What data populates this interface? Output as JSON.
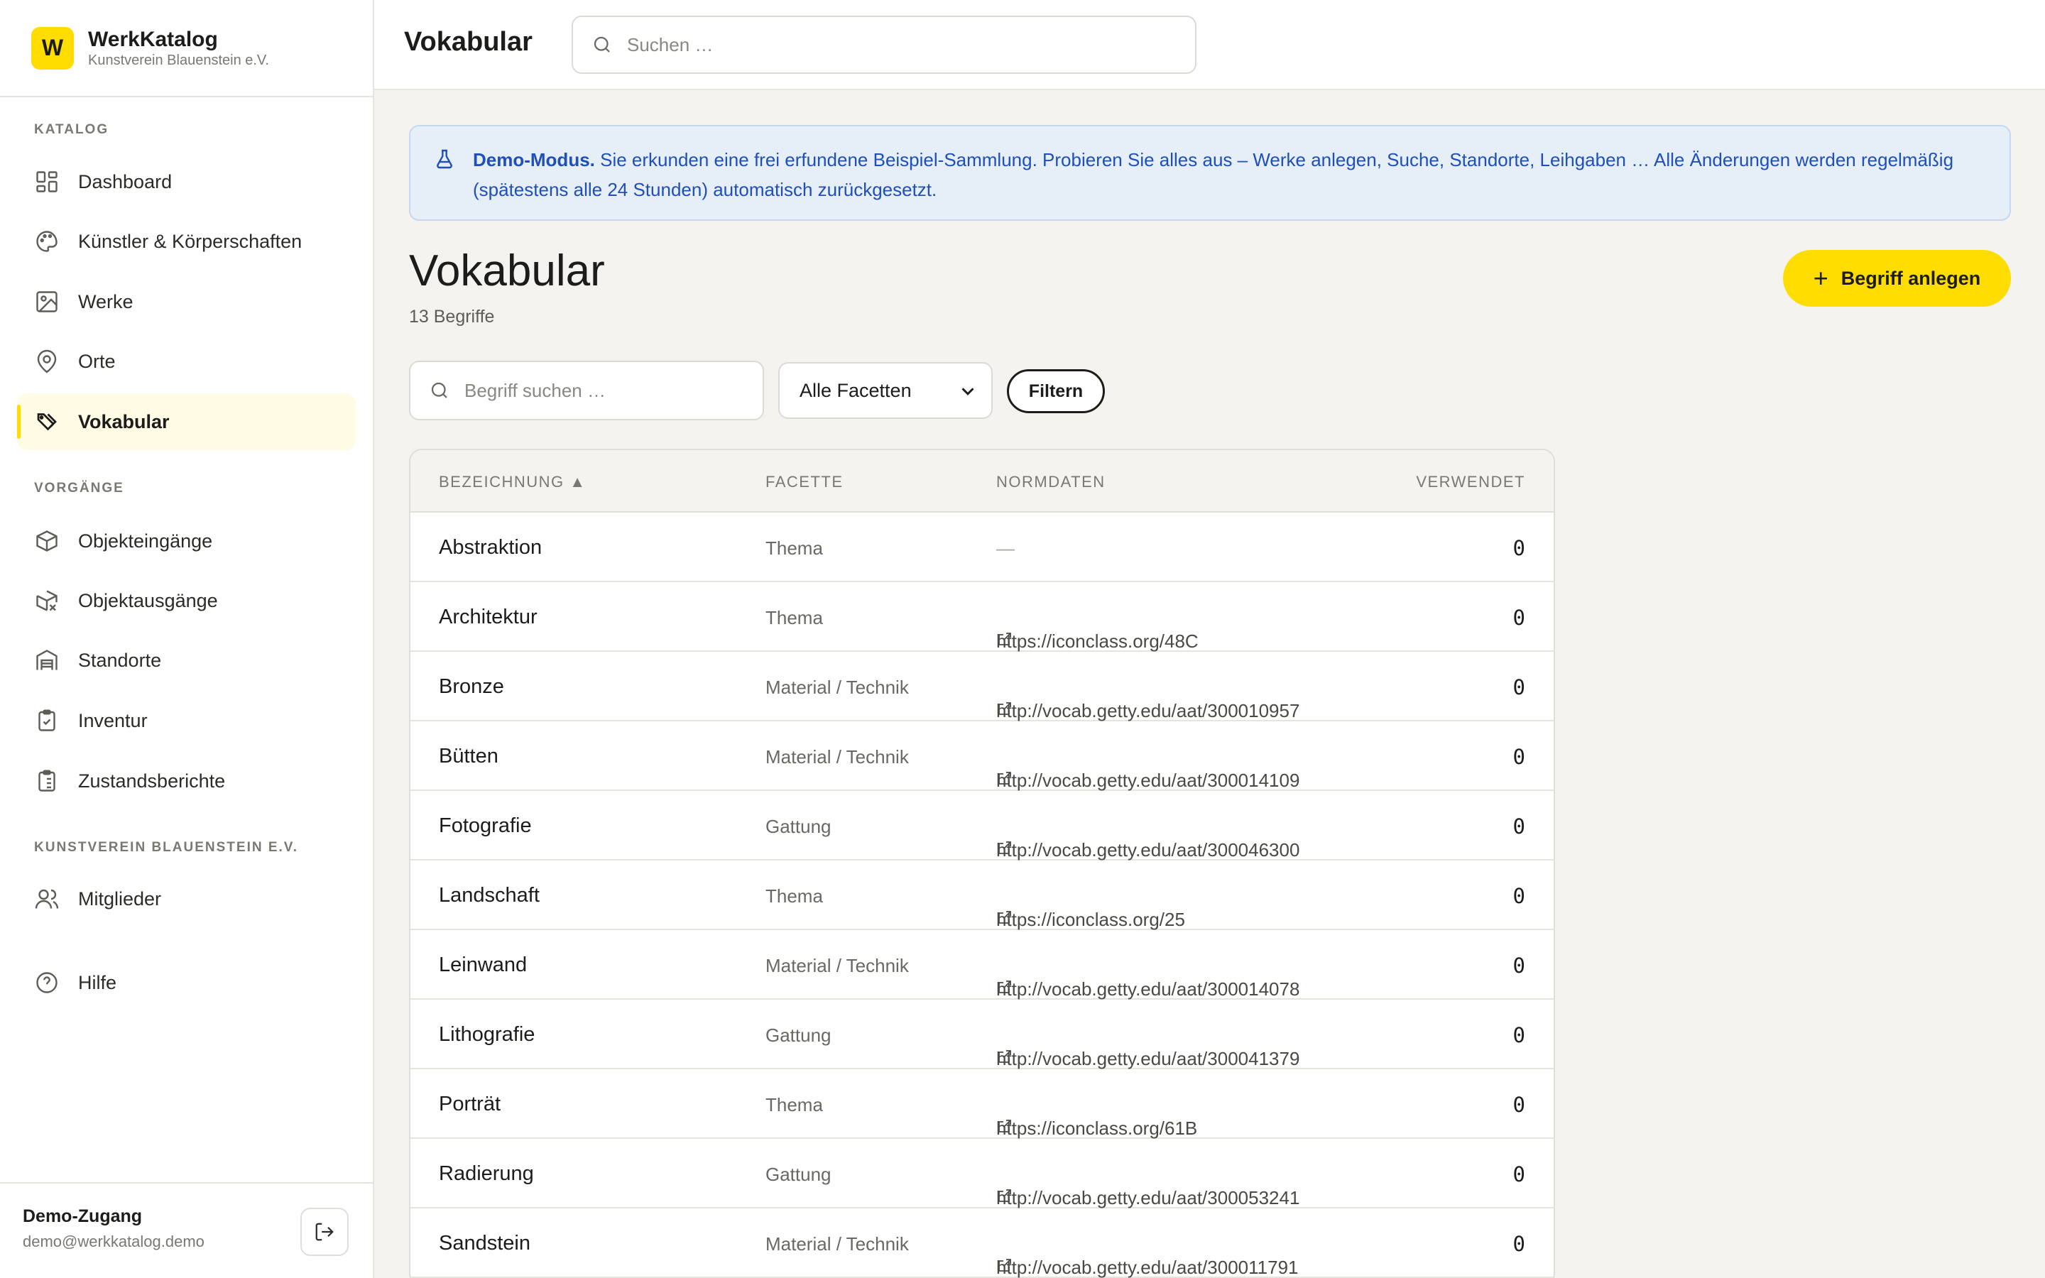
{
  "brand": {
    "logo_letter": "W",
    "title": "WerkKatalog",
    "subtitle": "Kunstverein Blauenstein e.V."
  },
  "sidebar": {
    "sections": [
      {
        "label": "KATALOG"
      },
      {
        "label": "VORGÄNGE"
      },
      {
        "label": "KUNSTVEREIN BLAUENSTEIN E.V."
      }
    ],
    "items": [
      {
        "label": "Dashboard",
        "icon": "dashboard-icon"
      },
      {
        "label": "Künstler & Körperschaften",
        "icon": "palette-icon"
      },
      {
        "label": "Werke",
        "icon": "image-icon"
      },
      {
        "label": "Orte",
        "icon": "map-pin-icon"
      },
      {
        "label": "Vokabular",
        "icon": "tag-icon",
        "active": true
      },
      {
        "label": "Objekteingänge",
        "icon": "box-in-icon"
      },
      {
        "label": "Objektausgänge",
        "icon": "box-out-icon"
      },
      {
        "label": "Standorte",
        "icon": "warehouse-icon"
      },
      {
        "label": "Inventur",
        "icon": "clipboard-check-icon"
      },
      {
        "label": "Zustandsberichte",
        "icon": "clipboard-list-icon"
      },
      {
        "label": "Mitglieder",
        "icon": "users-icon"
      },
      {
        "label": "Hilfe",
        "icon": "help-circle-icon"
      }
    ],
    "footer": {
      "user_name": "Demo-Zugang",
      "user_email": "demo@werkkatalog.demo"
    }
  },
  "topbar": {
    "title": "Vokabular",
    "search_placeholder": "Suchen …"
  },
  "banner": {
    "strong": "Demo-Modus.",
    "text": " Sie erkunden eine frei erfundene Beispiel-Sammlung. Probieren Sie alles aus – Werke anlegen, Suche, Standorte, Leihgaben … Alle Änderungen werden regelmäßig (spätestens alle 24 Stunden) automatisch zurückgesetzt.",
    "color": "#1f4fb8"
  },
  "page": {
    "title": "Vokabular",
    "count": "13 Begriffe",
    "add_label": "Begriff anlegen"
  },
  "filters": {
    "search_placeholder": "Begriff suchen …",
    "facet_selected": "Alle Facetten",
    "filter_label": "Filtern"
  },
  "table": {
    "headers": {
      "name": "BEZEICHNUNG ▲",
      "facet": "FACETTE",
      "norm": "NORMDATEN",
      "used": "VERWENDET"
    },
    "rows": [
      {
        "name": "Abstraktion",
        "facet": "Thema",
        "norm": "",
        "dash": "—",
        "used": "0"
      },
      {
        "name": "Architektur",
        "facet": "Thema",
        "norm": "https://iconclass.org/48C",
        "used": "0"
      },
      {
        "name": "Bronze",
        "facet": "Material / Technik",
        "norm": "http://vocab.getty.edu/aat/300010957",
        "used": "0"
      },
      {
        "name": "Bütten",
        "facet": "Material / Technik",
        "norm": "http://vocab.getty.edu/aat/300014109",
        "used": "0"
      },
      {
        "name": "Fotografie",
        "facet": "Gattung",
        "norm": "http://vocab.getty.edu/aat/300046300",
        "used": "0"
      },
      {
        "name": "Landschaft",
        "facet": "Thema",
        "norm": "https://iconclass.org/25",
        "used": "0"
      },
      {
        "name": "Leinwand",
        "facet": "Material / Technik",
        "norm": "http://vocab.getty.edu/aat/300014078",
        "used": "0"
      },
      {
        "name": "Lithografie",
        "facet": "Gattung",
        "norm": "http://vocab.getty.edu/aat/300041379",
        "used": "0"
      },
      {
        "name": "Porträt",
        "facet": "Thema",
        "norm": "https://iconclass.org/61B",
        "used": "0"
      },
      {
        "name": "Radierung",
        "facet": "Gattung",
        "norm": "http://vocab.getty.edu/aat/300053241",
        "used": "0"
      },
      {
        "name": "Sandstein",
        "facet": "Material / Technik",
        "norm": "http://vocab.getty.edu/aat/300011791",
        "used": "0"
      }
    ]
  },
  "colors": {
    "accent": "#ffdd00",
    "info_bg": "#e6eef8",
    "info_text": "#1f4fb8"
  }
}
